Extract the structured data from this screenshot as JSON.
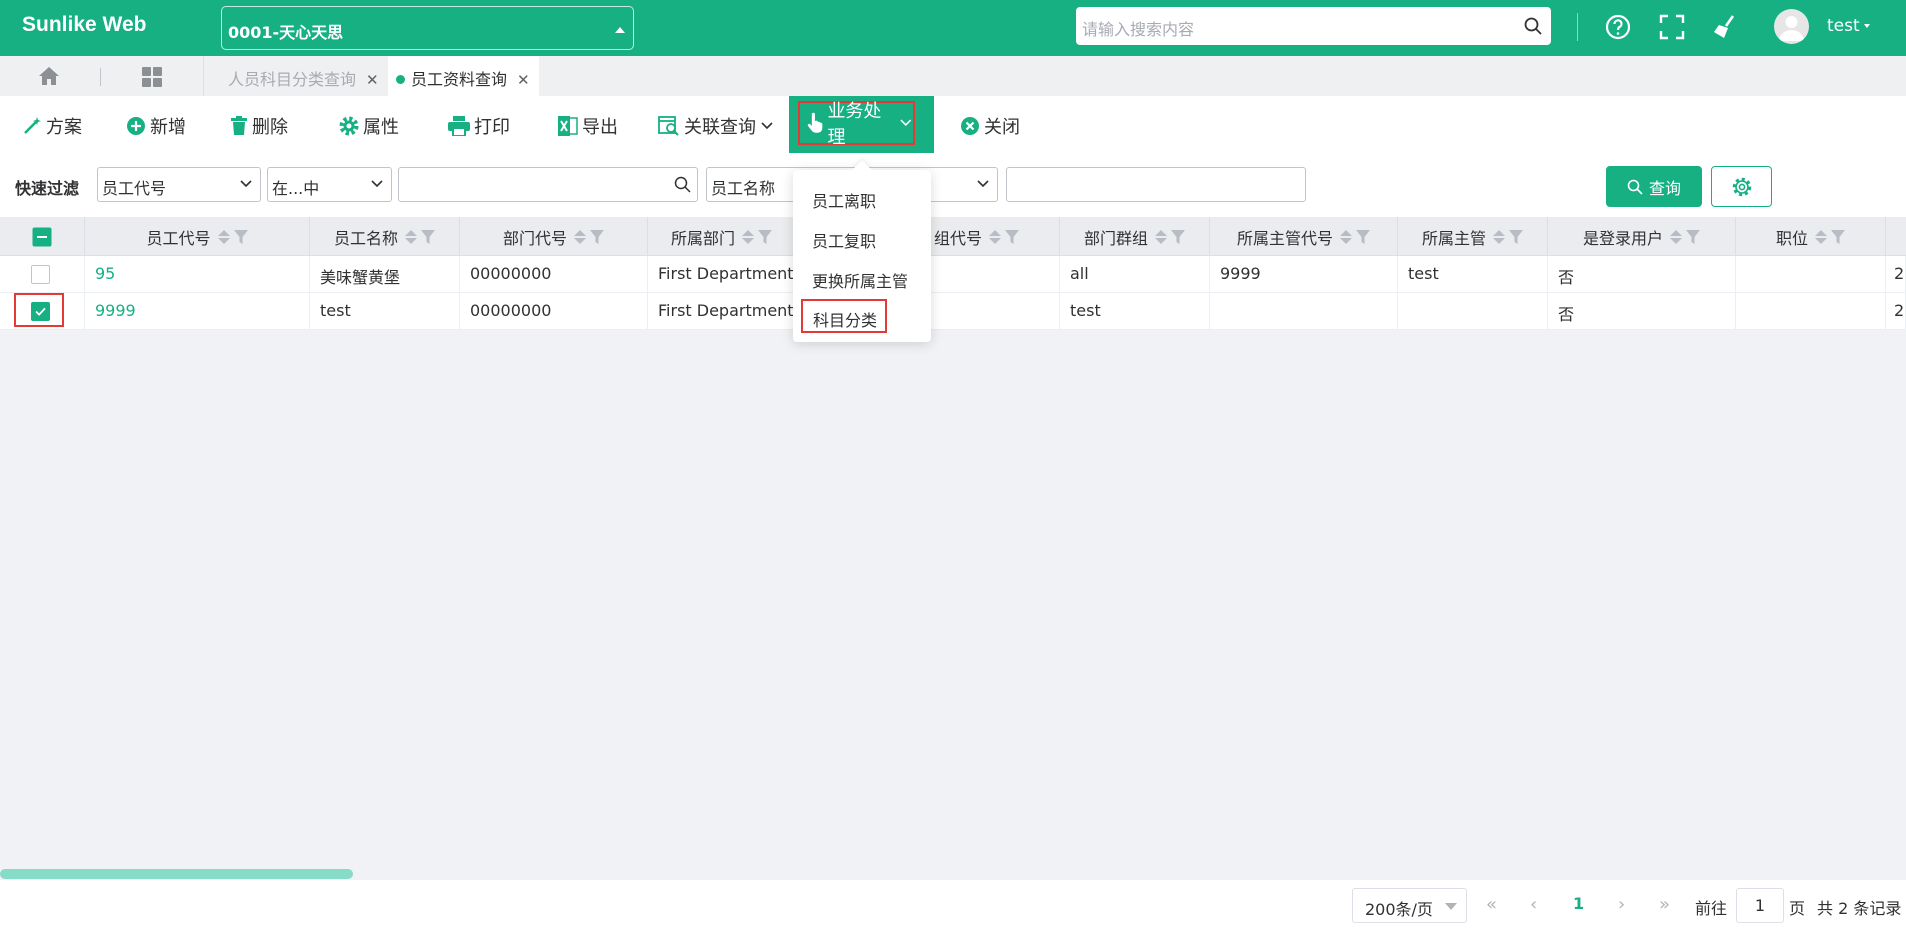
{
  "app": {
    "title": "Sunlike Web"
  },
  "header": {
    "company": "0001-天心天思",
    "search_placeholder": "请输入搜索内容",
    "user": "test"
  },
  "tabs": [
    {
      "label": "人员科目分类查询"
    },
    {
      "label": "员工资料查询"
    }
  ],
  "toolbar": {
    "scheme": "方案",
    "add": "新增",
    "delete": "删除",
    "props": "属性",
    "print": "打印",
    "export": "导出",
    "related": "关联查询",
    "business": "业务处理",
    "close": "关闭"
  },
  "filter": {
    "label": "快速过滤",
    "field1": "员工代号",
    "op1": "在...中",
    "value1": "",
    "field2": "员工名称",
    "value2": "",
    "query_button": "查询"
  },
  "grid": {
    "columns": [
      "员工代号",
      "员工名称",
      "部门代号",
      "所属部门",
      "组代号",
      "部门群组",
      "所属主管代号",
      "所属主管",
      "是登录用户",
      "职位"
    ],
    "rows": [
      {
        "checked": false,
        "cells": [
          "95",
          "美味蟹黄堡",
          "00000000",
          "First Department",
          "",
          "all",
          "9999",
          "test",
          "否",
          "",
          "2"
        ]
      },
      {
        "checked": true,
        "cells": [
          "9999",
          "test",
          "00000000",
          "First Department",
          "",
          "test",
          "",
          "",
          "否",
          "",
          "2"
        ]
      }
    ]
  },
  "business_menu": {
    "items": [
      "员工离职",
      "员工复职",
      "更换所属主管",
      "科目分类"
    ]
  },
  "pager": {
    "page_size": "200条/页",
    "current_page": "1",
    "goto_label": "前往",
    "goto_value": "1",
    "page_label": "页",
    "total": "共 2 条记录"
  },
  "colors": {
    "primary": "#16b083",
    "highlight": "#e53935"
  }
}
